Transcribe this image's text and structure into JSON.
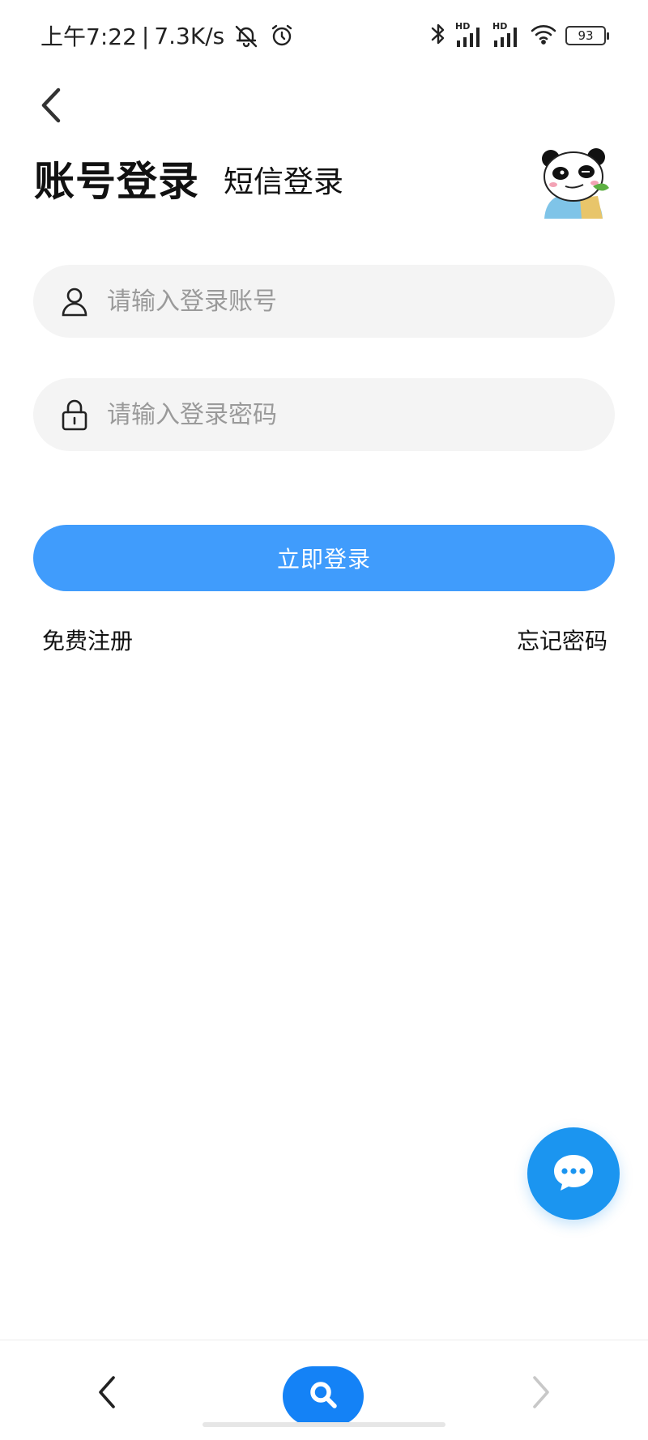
{
  "status_bar": {
    "time": "上午7:22",
    "separator": "|",
    "net_speed": "7.3K/s",
    "signal1_label": "HD",
    "signal2_label": "HD",
    "battery": "93"
  },
  "header": {
    "tab_account": "账号登录",
    "tab_sms": "短信登录"
  },
  "form": {
    "account_placeholder": "请输入登录账号",
    "account_value": "",
    "password_placeholder": "请输入登录密码",
    "password_value": "",
    "login_label": "立即登录",
    "register_label": "免费注册",
    "forgot_label": "忘记密码"
  },
  "icons": {
    "back": "chevron-left-icon",
    "user": "user-icon",
    "lock": "lock-icon",
    "chat": "chat-bubble-icon",
    "search": "search-icon",
    "forward": "chevron-right-icon"
  },
  "colors": {
    "primary": "#409cfc",
    "chat_fab": "#1b95f0",
    "search_pill": "#1482f6",
    "field_bg": "#f4f4f4",
    "placeholder": "#9a9a9a"
  }
}
